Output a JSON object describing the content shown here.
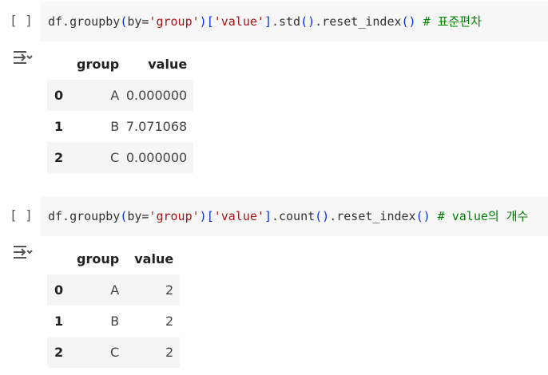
{
  "cells": [
    {
      "run_button": "[ ]",
      "code": {
        "prefix": "df.groupby",
        "p1": "(",
        "by": "by=",
        "str1": "'group'",
        "p2": ")",
        "br1": "[",
        "str2": "'value'",
        "br2": "]",
        "method": ".std",
        "p3": "()",
        "reset": ".reset_index",
        "p4": "()",
        "comment": " # 표준편차"
      },
      "output_icon": "output-toggle-icon",
      "table": {
        "columns": [
          "group",
          "value"
        ],
        "rows": [
          {
            "index": "0",
            "group": "A",
            "value": "0.000000"
          },
          {
            "index": "1",
            "group": "B",
            "value": "7.071068"
          },
          {
            "index": "2",
            "group": "C",
            "value": "0.000000"
          }
        ]
      }
    },
    {
      "run_button": "[ ]",
      "code": {
        "prefix": "df.groupby",
        "p1": "(",
        "by": "by=",
        "str1": "'group'",
        "p2": ")",
        "br1": "[",
        "str2": "'value'",
        "br2": "]",
        "method": ".count",
        "p3": "()",
        "reset": ".reset_index",
        "p4": "()",
        "comment": " # value의 개수"
      },
      "output_icon": "output-toggle-icon",
      "table": {
        "columns": [
          "group",
          "value"
        ],
        "rows": [
          {
            "index": "0",
            "group": "A",
            "value": "2"
          },
          {
            "index": "1",
            "group": "B",
            "value": "2"
          },
          {
            "index": "2",
            "group": "C",
            "value": "2"
          }
        ]
      }
    }
  ],
  "colors": {
    "editor_bg": "#f7f7f7",
    "string": "#a31515",
    "paren": "#0431fa",
    "comment": "#008000",
    "stripe": "#f5f5f5"
  }
}
